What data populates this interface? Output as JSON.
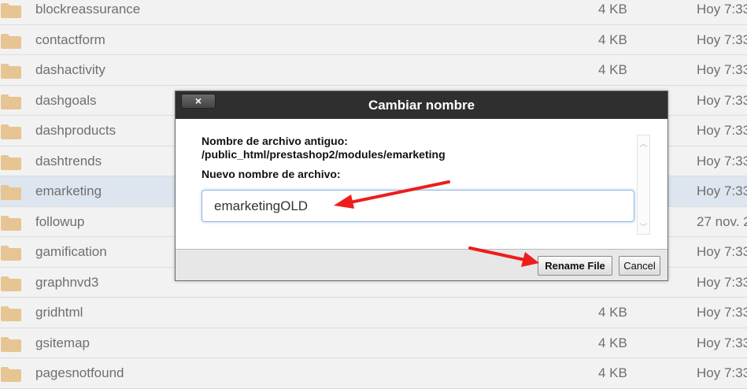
{
  "files": [
    {
      "name": "blockreassurance",
      "size": "4 KB",
      "date": "Hoy 7:33",
      "selected": false
    },
    {
      "name": "contactform",
      "size": "4 KB",
      "date": "Hoy 7:33",
      "selected": false
    },
    {
      "name": "dashactivity",
      "size": "4 KB",
      "date": "Hoy 7:33",
      "selected": false
    },
    {
      "name": "dashgoals",
      "size": "",
      "date": "Hoy 7:33",
      "selected": false
    },
    {
      "name": "dashproducts",
      "size": "",
      "date": "Hoy 7:33",
      "selected": false
    },
    {
      "name": "dashtrends",
      "size": "",
      "date": "Hoy 7:33",
      "selected": false
    },
    {
      "name": "emarketing",
      "size": "",
      "date": "Hoy 7:33",
      "selected": true
    },
    {
      "name": "followup",
      "size": "",
      "date": "27 nov. 2",
      "selected": false
    },
    {
      "name": "gamification",
      "size": "",
      "date": "Hoy 7:33",
      "selected": false
    },
    {
      "name": "graphnvd3",
      "size": "",
      "date": "Hoy 7:33",
      "selected": false
    },
    {
      "name": "gridhtml",
      "size": "4 KB",
      "date": "Hoy 7:33",
      "selected": false
    },
    {
      "name": "gsitemap",
      "size": "4 KB",
      "date": "Hoy 7:33",
      "selected": false
    },
    {
      "name": "pagesnotfound",
      "size": "4 KB",
      "date": "Hoy 7:33",
      "selected": false
    }
  ],
  "dialog": {
    "title": "Cambiar nombre",
    "close_label": "×",
    "old_name_label": "Nombre de archivo antiguo:",
    "old_path": "/public_html/prestashop2/modules/emarketing",
    "new_name_label": "Nuevo nombre de archivo:",
    "new_name_value": "emarketingOLD",
    "rename_button": "Rename File",
    "cancel_button": "Cancel"
  },
  "icons": {
    "folder": "folder-icon",
    "close": "close-icon",
    "annotation": "red-arrow"
  },
  "colors": {
    "folder": "#e6c593",
    "titlebar": "#2f2f2f",
    "annotation_arrow": "#ee1c1c",
    "selected_row": "#dde6ee"
  }
}
